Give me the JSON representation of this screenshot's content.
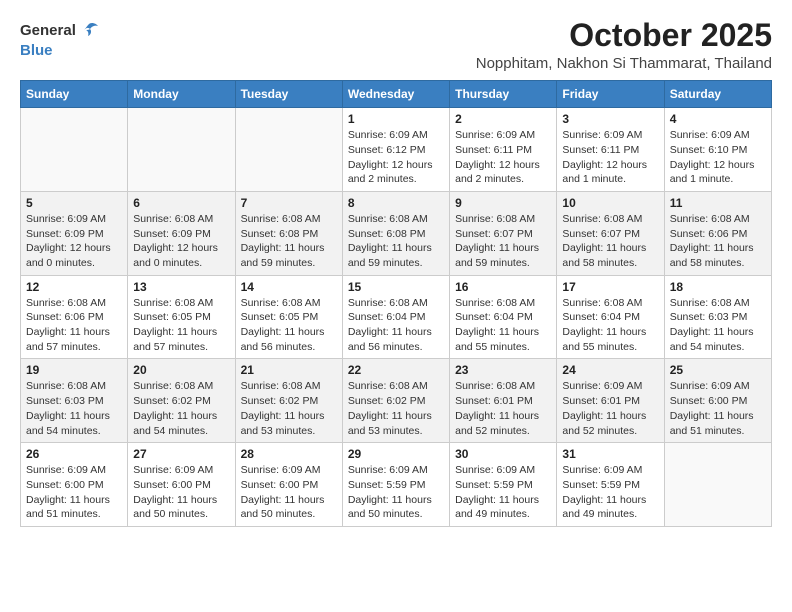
{
  "logo": {
    "general": "General",
    "blue": "Blue"
  },
  "header": {
    "month": "October 2025",
    "location": "Nopphitam, Nakhon Si Thammarat, Thailand"
  },
  "weekdays": [
    "Sunday",
    "Monday",
    "Tuesday",
    "Wednesday",
    "Thursday",
    "Friday",
    "Saturday"
  ],
  "weeks": [
    [
      {
        "day": "",
        "info": ""
      },
      {
        "day": "",
        "info": ""
      },
      {
        "day": "",
        "info": ""
      },
      {
        "day": "1",
        "info": "Sunrise: 6:09 AM\nSunset: 6:12 PM\nDaylight: 12 hours\nand 2 minutes."
      },
      {
        "day": "2",
        "info": "Sunrise: 6:09 AM\nSunset: 6:11 PM\nDaylight: 12 hours\nand 2 minutes."
      },
      {
        "day": "3",
        "info": "Sunrise: 6:09 AM\nSunset: 6:11 PM\nDaylight: 12 hours\nand 1 minute."
      },
      {
        "day": "4",
        "info": "Sunrise: 6:09 AM\nSunset: 6:10 PM\nDaylight: 12 hours\nand 1 minute."
      }
    ],
    [
      {
        "day": "5",
        "info": "Sunrise: 6:09 AM\nSunset: 6:09 PM\nDaylight: 12 hours\nand 0 minutes."
      },
      {
        "day": "6",
        "info": "Sunrise: 6:08 AM\nSunset: 6:09 PM\nDaylight: 12 hours\nand 0 minutes."
      },
      {
        "day": "7",
        "info": "Sunrise: 6:08 AM\nSunset: 6:08 PM\nDaylight: 11 hours\nand 59 minutes."
      },
      {
        "day": "8",
        "info": "Sunrise: 6:08 AM\nSunset: 6:08 PM\nDaylight: 11 hours\nand 59 minutes."
      },
      {
        "day": "9",
        "info": "Sunrise: 6:08 AM\nSunset: 6:07 PM\nDaylight: 11 hours\nand 59 minutes."
      },
      {
        "day": "10",
        "info": "Sunrise: 6:08 AM\nSunset: 6:07 PM\nDaylight: 11 hours\nand 58 minutes."
      },
      {
        "day": "11",
        "info": "Sunrise: 6:08 AM\nSunset: 6:06 PM\nDaylight: 11 hours\nand 58 minutes."
      }
    ],
    [
      {
        "day": "12",
        "info": "Sunrise: 6:08 AM\nSunset: 6:06 PM\nDaylight: 11 hours\nand 57 minutes."
      },
      {
        "day": "13",
        "info": "Sunrise: 6:08 AM\nSunset: 6:05 PM\nDaylight: 11 hours\nand 57 minutes."
      },
      {
        "day": "14",
        "info": "Sunrise: 6:08 AM\nSunset: 6:05 PM\nDaylight: 11 hours\nand 56 minutes."
      },
      {
        "day": "15",
        "info": "Sunrise: 6:08 AM\nSunset: 6:04 PM\nDaylight: 11 hours\nand 56 minutes."
      },
      {
        "day": "16",
        "info": "Sunrise: 6:08 AM\nSunset: 6:04 PM\nDaylight: 11 hours\nand 55 minutes."
      },
      {
        "day": "17",
        "info": "Sunrise: 6:08 AM\nSunset: 6:04 PM\nDaylight: 11 hours\nand 55 minutes."
      },
      {
        "day": "18",
        "info": "Sunrise: 6:08 AM\nSunset: 6:03 PM\nDaylight: 11 hours\nand 54 minutes."
      }
    ],
    [
      {
        "day": "19",
        "info": "Sunrise: 6:08 AM\nSunset: 6:03 PM\nDaylight: 11 hours\nand 54 minutes."
      },
      {
        "day": "20",
        "info": "Sunrise: 6:08 AM\nSunset: 6:02 PM\nDaylight: 11 hours\nand 54 minutes."
      },
      {
        "day": "21",
        "info": "Sunrise: 6:08 AM\nSunset: 6:02 PM\nDaylight: 11 hours\nand 53 minutes."
      },
      {
        "day": "22",
        "info": "Sunrise: 6:08 AM\nSunset: 6:02 PM\nDaylight: 11 hours\nand 53 minutes."
      },
      {
        "day": "23",
        "info": "Sunrise: 6:08 AM\nSunset: 6:01 PM\nDaylight: 11 hours\nand 52 minutes."
      },
      {
        "day": "24",
        "info": "Sunrise: 6:09 AM\nSunset: 6:01 PM\nDaylight: 11 hours\nand 52 minutes."
      },
      {
        "day": "25",
        "info": "Sunrise: 6:09 AM\nSunset: 6:00 PM\nDaylight: 11 hours\nand 51 minutes."
      }
    ],
    [
      {
        "day": "26",
        "info": "Sunrise: 6:09 AM\nSunset: 6:00 PM\nDaylight: 11 hours\nand 51 minutes."
      },
      {
        "day": "27",
        "info": "Sunrise: 6:09 AM\nSunset: 6:00 PM\nDaylight: 11 hours\nand 50 minutes."
      },
      {
        "day": "28",
        "info": "Sunrise: 6:09 AM\nSunset: 6:00 PM\nDaylight: 11 hours\nand 50 minutes."
      },
      {
        "day": "29",
        "info": "Sunrise: 6:09 AM\nSunset: 5:59 PM\nDaylight: 11 hours\nand 50 minutes."
      },
      {
        "day": "30",
        "info": "Sunrise: 6:09 AM\nSunset: 5:59 PM\nDaylight: 11 hours\nand 49 minutes."
      },
      {
        "day": "31",
        "info": "Sunrise: 6:09 AM\nSunset: 5:59 PM\nDaylight: 11 hours\nand 49 minutes."
      },
      {
        "day": "",
        "info": ""
      }
    ]
  ]
}
